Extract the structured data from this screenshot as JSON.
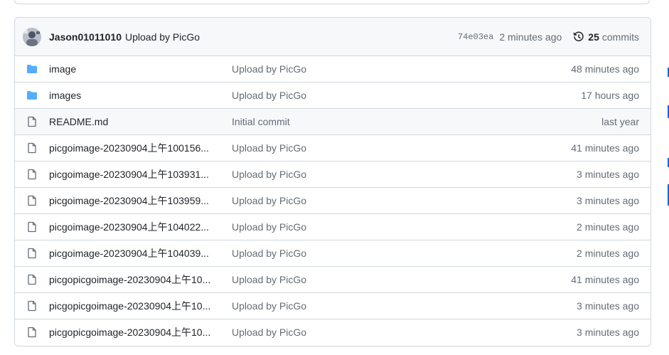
{
  "commit": {
    "author": "Jason01011010",
    "message": "Upload by PicGo",
    "sha": "74e03ea",
    "age": "2 minutes ago",
    "commits_count": "25",
    "commits_label": "commits"
  },
  "files": [
    {
      "type": "folder",
      "name": "image",
      "message": "Upload by PicGo",
      "age": "48 minutes ago"
    },
    {
      "type": "folder",
      "name": "images",
      "message": "Upload by PicGo",
      "age": "17 hours ago"
    },
    {
      "type": "file",
      "name": "README.md",
      "message": "Initial commit",
      "age": "last year"
    },
    {
      "type": "file",
      "name": "picgoimage-20230904上午100156...",
      "message": "Upload by PicGo",
      "age": "41 minutes ago"
    },
    {
      "type": "file",
      "name": "picgoimage-20230904上午103931...",
      "message": "Upload by PicGo",
      "age": "3 minutes ago"
    },
    {
      "type": "file",
      "name": "picgoimage-20230904上午103959...",
      "message": "Upload by PicGo",
      "age": "3 minutes ago"
    },
    {
      "type": "file",
      "name": "picgoimage-20230904上午104022...",
      "message": "Upload by PicGo",
      "age": "2 minutes ago"
    },
    {
      "type": "file",
      "name": "picgoimage-20230904上午104039...",
      "message": "Upload by PicGo",
      "age": "2 minutes ago"
    },
    {
      "type": "file",
      "name": "picgopicgoimage-20230904上午10...",
      "message": "Upload by PicGo",
      "age": "41 minutes ago"
    },
    {
      "type": "file",
      "name": "picgopicgoimage-20230904上午10...",
      "message": "Upload by PicGo",
      "age": "3 minutes ago"
    },
    {
      "type": "file",
      "name": "picgopicgoimage-20230904上午10...",
      "message": "Upload by PicGo",
      "age": "3 minutes ago"
    }
  ],
  "colors": {
    "folder": "#54aeff",
    "file_icon": "#636c76",
    "muted_text": "#636c76",
    "border": "#d0d7de",
    "header_bg": "#f6f8fa"
  }
}
